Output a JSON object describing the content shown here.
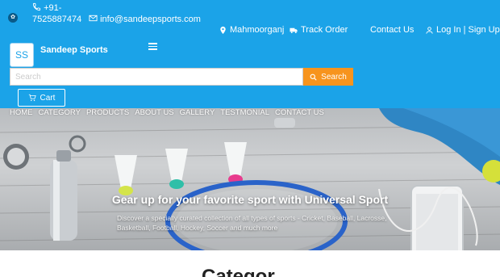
{
  "topbar": {
    "phone": "+91-7525887474",
    "phone_line1": "+91-",
    "phone_line2": "7525887474",
    "email": "info@sandeepsports.com",
    "location": "Mahmoorganj",
    "track_order": "Track Order",
    "contact_us": "Contact Us",
    "login": "Log In | Sign Up"
  },
  "header": {
    "logo_text": "SS",
    "brand": "Sandeep Sports",
    "search_placeholder": "Search",
    "search_button": "Search",
    "cart_label": "Cart"
  },
  "nav": {
    "items": [
      "HOME",
      "CATEGORY",
      "PRODUCTS",
      "ABOUT US",
      "GALLERY",
      "TESTMONIAL",
      "CONTACT US"
    ]
  },
  "hero": {
    "title": "Gear up for your favorite sport with Universal Sport",
    "subtitle": "Discover a specially curated collection of all types of sports - Cricket, Baseball, Lacrosse, Basketball, Football, Hockey, Soccer and much more"
  },
  "section": {
    "heading": "Categor"
  },
  "colors": {
    "header_blue": "#1ba3e8",
    "search_orange": "#f7941d"
  }
}
